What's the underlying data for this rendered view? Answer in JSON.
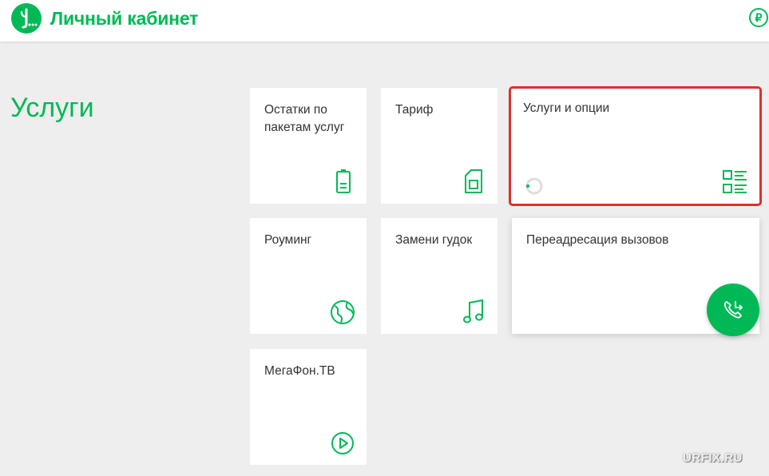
{
  "header": {
    "title": "Личный кабинет",
    "ruble_symbol": "₽"
  },
  "page": {
    "title": "Услуги"
  },
  "tiles": [
    {
      "label": "Остатки по пакетам услуг",
      "icon": "battery-icon"
    },
    {
      "label": "Тариф",
      "icon": "sim-card-icon"
    },
    {
      "label": "Услуги и опции",
      "icon": "services-list-icon",
      "selected": true,
      "loading": true
    },
    {
      "label": "Роуминг",
      "icon": "globe-icon"
    },
    {
      "label": "Замени гудок",
      "icon": "music-note-icon"
    },
    {
      "label": "Переадресация вызовов",
      "icon": "call-forward-icon"
    },
    {
      "label": "МегаФон.ТВ",
      "icon": "play-icon"
    }
  ],
  "watermark": "URFIX.RU",
  "colors": {
    "accent": "#00b956",
    "highlight_border": "#d9322c",
    "background": "#eeeeee",
    "tile": "#ffffff",
    "text": "#333333"
  }
}
